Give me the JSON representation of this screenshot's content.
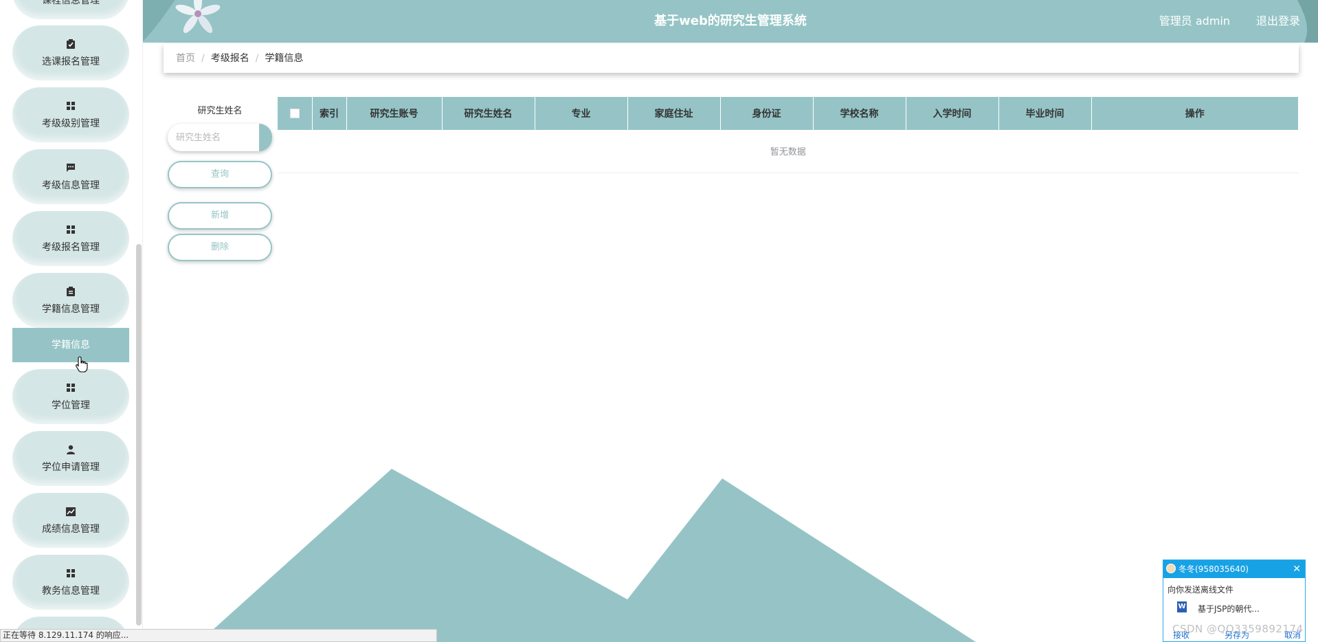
{
  "header": {
    "title": "基于web的研究生管理系统",
    "user": "管理员 admin",
    "logout": "退出登录"
  },
  "sidebar": {
    "items": [
      {
        "label": "课程信息管理",
        "icon": "grid-icon"
      },
      {
        "label": "选课报名管理",
        "icon": "clipboard-check-icon"
      },
      {
        "label": "考级级别管理",
        "icon": "grid-icon"
      },
      {
        "label": "考级信息管理",
        "icon": "chat-icon"
      },
      {
        "label": "考级报名管理",
        "icon": "grid-icon"
      },
      {
        "label": "学籍信息管理",
        "icon": "clipboard-icon"
      },
      {
        "label": "学位管理",
        "icon": "grid-icon"
      },
      {
        "label": "学位申请管理",
        "icon": "person-icon"
      },
      {
        "label": "成绩信息管理",
        "icon": "chart-icon"
      },
      {
        "label": "教务信息管理",
        "icon": "grid-icon"
      }
    ],
    "active_sub": "学籍信息"
  },
  "breadcrumb": {
    "home": "首页",
    "level1": "考级报名",
    "current": "学籍信息"
  },
  "search": {
    "label": "研究生姓名",
    "placeholder": "研究生姓名",
    "query_btn": "查询",
    "add_btn": "新增",
    "delete_btn": "删除"
  },
  "table": {
    "columns": [
      "索引",
      "研究生账号",
      "研究生姓名",
      "专业",
      "家庭住址",
      "身份证",
      "学校名称",
      "入学时间",
      "毕业时间",
      "操作"
    ],
    "empty_text": "暂无数据"
  },
  "qq_popup": {
    "title": "冬冬(958035640)",
    "message": "向你发送离线文件",
    "file": "基于JSP的朝代...",
    "actions": [
      "接收",
      "另存为",
      "取消"
    ]
  },
  "watermark": "CSDN @QQ3359892174",
  "status": "正在等待 8.129.11.174 的响应...",
  "colors": {
    "accent": "#96c4c6",
    "menu_bg": "#d5e6e6"
  }
}
